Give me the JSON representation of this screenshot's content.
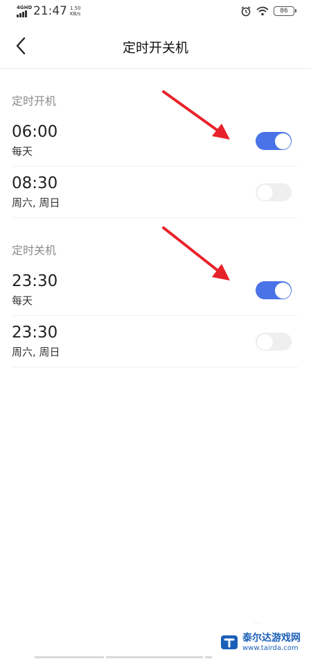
{
  "status_bar": {
    "network_type": "4GHD",
    "time": "21:47",
    "speed_value": "1.50",
    "speed_unit": "KB/s",
    "battery": "86",
    "icons": [
      "alarm-icon",
      "wifi-icon",
      "battery-icon"
    ]
  },
  "header": {
    "title": "定时开关机",
    "back_icon": "chevron-left-icon"
  },
  "sections": [
    {
      "title": "定时开机",
      "items": [
        {
          "time": "06:00",
          "repeat": "每天",
          "enabled": true
        },
        {
          "time": "08:30",
          "repeat": "周六, 周日",
          "enabled": false
        }
      ]
    },
    {
      "title": "定时关机",
      "items": [
        {
          "time": "23:30",
          "repeat": "每天",
          "enabled": true
        },
        {
          "time": "23:30",
          "repeat": "周六, 周日",
          "enabled": false
        }
      ]
    }
  ],
  "watermark": {
    "name": "泰尔达游戏网",
    "url": "www.tairda.com"
  },
  "colors": {
    "toggle_on": "#4a73e8",
    "toggle_off": "#efefef",
    "arrow": "#e8222a",
    "watermark": "#1b5fb8"
  }
}
